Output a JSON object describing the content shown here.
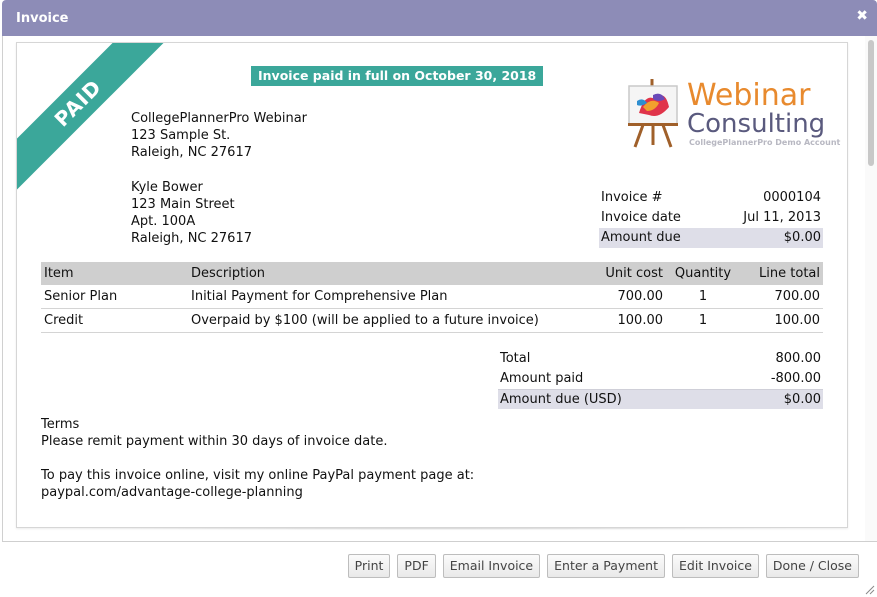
{
  "window": {
    "title": "Invoice",
    "close_glyph": "✖"
  },
  "stamp": {
    "ribbon": "PAID",
    "banner": "Invoice paid in full on October 30, 2018",
    "color": "#3ba79a"
  },
  "logo": {
    "line1": "Webinar",
    "line2": "Consulting",
    "tagline": "CollegePlannerPro Demo Account",
    "icon": "easel-painting-icon"
  },
  "sender": {
    "lines": [
      "CollegePlannerPro Webinar",
      "123 Sample St.",
      "Raleigh, NC 27617"
    ]
  },
  "recipient": {
    "lines": [
      "Kyle Bower",
      "123 Main Street",
      "Apt. 100A",
      "Raleigh, NC 27617"
    ]
  },
  "meta": {
    "invoice_no_label": "Invoice #",
    "invoice_no": "0000104",
    "date_label": "Invoice date",
    "date": "Jul 11, 2013",
    "due_label": "Amount due",
    "due": "$0.00"
  },
  "items": {
    "headers": {
      "item": "Item",
      "description": "Description",
      "unit_cost": "Unit cost",
      "quantity": "Quantity",
      "line_total": "Line total"
    },
    "rows": [
      {
        "item": "Senior Plan",
        "description": "Initial Payment for Comprehensive Plan",
        "unit_cost": "700.00",
        "quantity": "1",
        "line_total": "700.00"
      },
      {
        "item": "Credit",
        "description": "Overpaid by $100 (will be applied to a future invoice)",
        "unit_cost": "100.00",
        "quantity": "1",
        "line_total": "100.00"
      }
    ]
  },
  "totals": {
    "total_label": "Total",
    "total": "800.00",
    "paid_label": "Amount paid",
    "paid": "-800.00",
    "due_label": "Amount due (USD)",
    "due": "$0.00"
  },
  "terms": {
    "heading": "Terms",
    "text": "Please remit payment within 30 days of invoice date.",
    "paypal_text": "To pay this invoice online, visit my online PayPal payment page at:",
    "paypal_url": "paypal.com/advantage-college-planning"
  },
  "buttons": {
    "print": "Print",
    "pdf": "PDF",
    "email": "Email Invoice",
    "payment": "Enter a Payment",
    "edit": "Edit Invoice",
    "done": "Done / Close"
  }
}
